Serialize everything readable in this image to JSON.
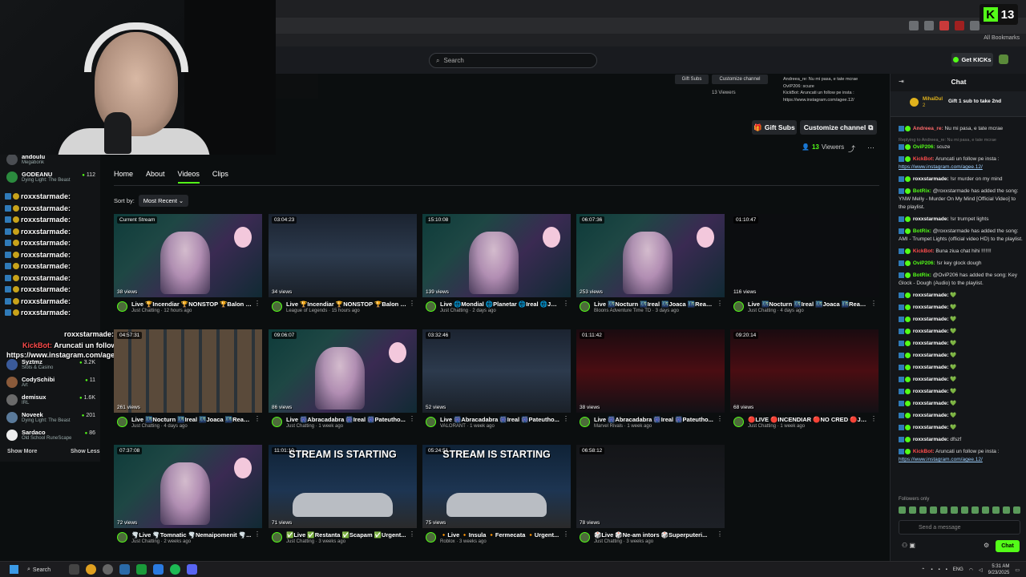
{
  "browser": {
    "all_bookmarks": "All Bookmarks",
    "kick_counter": "13"
  },
  "topnav": {
    "search_placeholder": "Search",
    "get_kicks": "Get KICKs"
  },
  "preview": {
    "gift_subs": "Gift Subs",
    "customize": "Customize channel",
    "viewers": "13 Viewers",
    "chat_lines": [
      "Andreea_re: Nu mi pasa, e tate mcrae",
      "OvIP206: scuze",
      "KickBot: Aruncati un follow pe insta :",
      "https://www.instagram.com/agee.12/"
    ]
  },
  "channel": {
    "gift_subs": "Gift Subs",
    "customize": "Customize channel",
    "viewers_num": "13",
    "viewers_label": "Viewers",
    "tabs": [
      "Home",
      "About",
      "Videos",
      "Clips"
    ],
    "sort_label": "Sort by:",
    "sort_value": "Most Recent"
  },
  "sidebar": {
    "items": [
      {
        "name": "andoulu",
        "game": "Megabonk",
        "viewers": ""
      },
      {
        "name": "GODEANU",
        "game": "Dying Light: The Beast",
        "viewers": "112"
      },
      {
        "name": "Syztmz",
        "game": "Slots & Casino",
        "viewers": "3.2K"
      },
      {
        "name": "CodySchibi",
        "game": "Art",
        "viewers": "11"
      },
      {
        "name": "demisux",
        "game": "IRL",
        "viewers": "1.6K"
      },
      {
        "name": "Noveek",
        "game": "Dying Light: The Beast",
        "viewers": "201"
      },
      {
        "name": "Sardaco",
        "game": "Old School RuneScape",
        "viewers": "86"
      }
    ],
    "show_more": "Show More",
    "show_less": "Show Less"
  },
  "overlay_chat": {
    "user": "roxxstarmade:",
    "rows": 11,
    "last_line": "roxxstarmade: dfszf",
    "kickbot_prefix": "KickBot:",
    "kickbot_msg": "Aruncati un follow pe insta :",
    "kickbot_link": "https://www.instagram.com/agee.12/"
  },
  "videos": [
    {
      "duration": "Current Stream",
      "views": "38 views",
      "title": "Live 🏆Incendiar 🏆NONSTOP 🏆Balon D...",
      "sub": "Just Chatting · 12 hours ago",
      "thumb": "t-anime"
    },
    {
      "duration": "03:04:23",
      "views": "34 views",
      "title": "Live 🏆Incendiar 🏆NONSTOP 🏆Balon D...",
      "sub": "League of Legends · 15 hours ago",
      "thumb": "t-game"
    },
    {
      "duration": "15:10:08",
      "views": "139 views",
      "title": "Live 🌐Mondial 🌐Planetar 🌐Ireal 🌐Joa...",
      "sub": "Just Chatting · 2 days ago",
      "thumb": "t-anime"
    },
    {
      "duration": "06:07:36",
      "views": "253 views",
      "title": "Live 🌃Nocturn 🌃Ireal 🌃Joaca 🌃React...",
      "sub": "Bloons Adventure Time TD · 3 days ago",
      "thumb": "t-anime"
    },
    {
      "duration": "01:10:47",
      "views": "116 views",
      "title": "Live 🌃Nocturn 🌃Ireal 🌃Joaca 🌃React...",
      "sub": "Just Chatting · 4 days ago",
      "thumb": "t-dark"
    },
    {
      "duration": "04:57:31",
      "views": "261 views",
      "title": "Live 🌃Nocturn 🌃Ireal 🌃Joaca 🌃React...",
      "sub": "Just Chatting · 4 days ago",
      "thumb": "t-grid"
    },
    {
      "duration": "09:06:07",
      "views": "86 views",
      "title": "Live 🎆Abracadabra 🎆Ireal 🎆Pateutho...",
      "sub": "Just Chatting · 1 week ago",
      "thumb": "t-anime"
    },
    {
      "duration": "03:32:46",
      "views": "52 views",
      "title": "Live 🎆Abracadabra 🎆Ireal 🎆Pateutho...",
      "sub": "VALORANT · 1 week ago",
      "thumb": "t-game"
    },
    {
      "duration": "01:11:42",
      "views": "38 views",
      "title": "Live 🎆Abracadabra 🎆Ireal 🎆Pateutho...",
      "sub": "Marvel Rivals · 1 week ago",
      "thumb": "t-red"
    },
    {
      "duration": "09:20:14",
      "views": "68 views",
      "title": "🔴LIVE 🔴INCENDIAR 🔴NO CRED 🔴Jo...",
      "sub": "Just Chatting · 1 week ago",
      "thumb": "t-red"
    },
    {
      "duration": "07:37:08",
      "views": "72 views",
      "title": "🌪️Live 🌪️Tomnatic 🌪️Nemaipomenit 🌪️...",
      "sub": "Just Chatting · 2 weeks ago",
      "thumb": "t-anime"
    },
    {
      "duration": "11:01:10",
      "views": "71 views",
      "title": "✅Live ✅Restanta ✅Scapam ✅Urgent...",
      "sub": "Just Chatting · 3 weeks ago",
      "thumb": "t-start",
      "banner": "STREAM IS STARTING"
    },
    {
      "duration": "05:24:51",
      "views": "75 views",
      "title": "🔸Live 🔸Insula 🔸Fermecata 🔸Urgent...",
      "sub": "Roblox · 3 weeks ago",
      "thumb": "t-start",
      "banner": "STREAM IS STARTING"
    },
    {
      "duration": "06:58:12",
      "views": "78 views",
      "title": "🎲Live 🎲Ne-am intors 🎲Superputeri...",
      "sub": "Just Chatting · 3 weeks ago",
      "thumb": "t-editor"
    }
  ],
  "chat": {
    "title": "Chat",
    "pinned_user": "MihaiDul",
    "pinned_count": "2",
    "pinned_msg": "Gift 1 sub to take 2nd",
    "messages": [
      {
        "reply": "",
        "user": "Andreea_re:",
        "color": "#ff6b6b",
        "text": " Nu mi pasa, e tate mcrae"
      },
      {
        "reply": "Replying to Andreea_re: Nu mi pasa, e tate mcrae",
        "user": "OviP206:",
        "color": "#53fc18",
        "text": " scuze"
      },
      {
        "reply": "",
        "user": "KickBot:",
        "color": "#ff4d4d",
        "text": " Aruncati un follow pe insta :",
        "link": "https://www.instagram.com/agee.12/"
      },
      {
        "reply": "",
        "user": "roxxstarmade:",
        "color": "#ffffff",
        "text": " !sr murder on my mind"
      },
      {
        "reply": "",
        "user": "BotRix:",
        "color": "#53fc18",
        "text": " @roxxstarmade has added the song: YNW Melly - Murder On My Mind [Official Video] to the playlist."
      },
      {
        "reply": "",
        "user": "roxxstarmade:",
        "color": "#ffffff",
        "text": " !sr trumpet lights"
      },
      {
        "reply": "",
        "user": "BotRix:",
        "color": "#53fc18",
        "text": " @roxxstarmade has added the song: AMI - Trumpet Lights (official video HD) to the playlist."
      },
      {
        "reply": "",
        "user": "KickBot:",
        "color": "#ff4d4d",
        "text": " Buna ziua chat hihi !!!!!!!"
      },
      {
        "reply": "",
        "user": "OviP206:",
        "color": "#53fc18",
        "text": " !sr key glock dough"
      },
      {
        "reply": "",
        "user": "BotRix:",
        "color": "#53fc18",
        "text": " @OviP206 has added the song: Key Glock - Dough (Audio) to the playlist."
      },
      {
        "reply": "",
        "user": "roxxstarmade:",
        "color": "#ffffff",
        "text": " 💚"
      },
      {
        "reply": "",
        "user": "roxxstarmade:",
        "color": "#ffffff",
        "text": " 💚"
      },
      {
        "reply": "",
        "user": "roxxstarmade:",
        "color": "#ffffff",
        "text": " 💚"
      },
      {
        "reply": "",
        "user": "roxxstarmade:",
        "color": "#ffffff",
        "text": " 💚"
      },
      {
        "reply": "",
        "user": "roxxstarmade:",
        "color": "#ffffff",
        "text": " 💚"
      },
      {
        "reply": "",
        "user": "roxxstarmade:",
        "color": "#ffffff",
        "text": " 💚"
      },
      {
        "reply": "",
        "user": "roxxstarmade:",
        "color": "#ffffff",
        "text": " 💚"
      },
      {
        "reply": "",
        "user": "roxxstarmade:",
        "color": "#ffffff",
        "text": " 💚"
      },
      {
        "reply": "",
        "user": "roxxstarmade:",
        "color": "#ffffff",
        "text": " 💚"
      },
      {
        "reply": "",
        "user": "roxxstarmade:",
        "color": "#ffffff",
        "text": " 💚"
      },
      {
        "reply": "",
        "user": "roxxstarmade:",
        "color": "#ffffff",
        "text": " 💚"
      },
      {
        "reply": "",
        "user": "roxxstarmade:",
        "color": "#ffffff",
        "text": " 💚"
      },
      {
        "reply": "",
        "user": "roxxstarmade:",
        "color": "#ffffff",
        "text": " dfszf"
      },
      {
        "reply": "",
        "user": "KickBot:",
        "color": "#ff4d4d",
        "text": " Aruncati un follow pe insta :",
        "link": "https://www.instagram.com/agee.12/"
      }
    ],
    "followers_only": "Followers only",
    "input_placeholder": "Send a message",
    "send": "Chat"
  },
  "taskbar": {
    "search": "Search",
    "lang": "ENG",
    "time": "5:31 AM",
    "date": "9/23/2025"
  },
  "colors": {
    "accent": "#53fc18",
    "bg": "#0b0e0f"
  }
}
